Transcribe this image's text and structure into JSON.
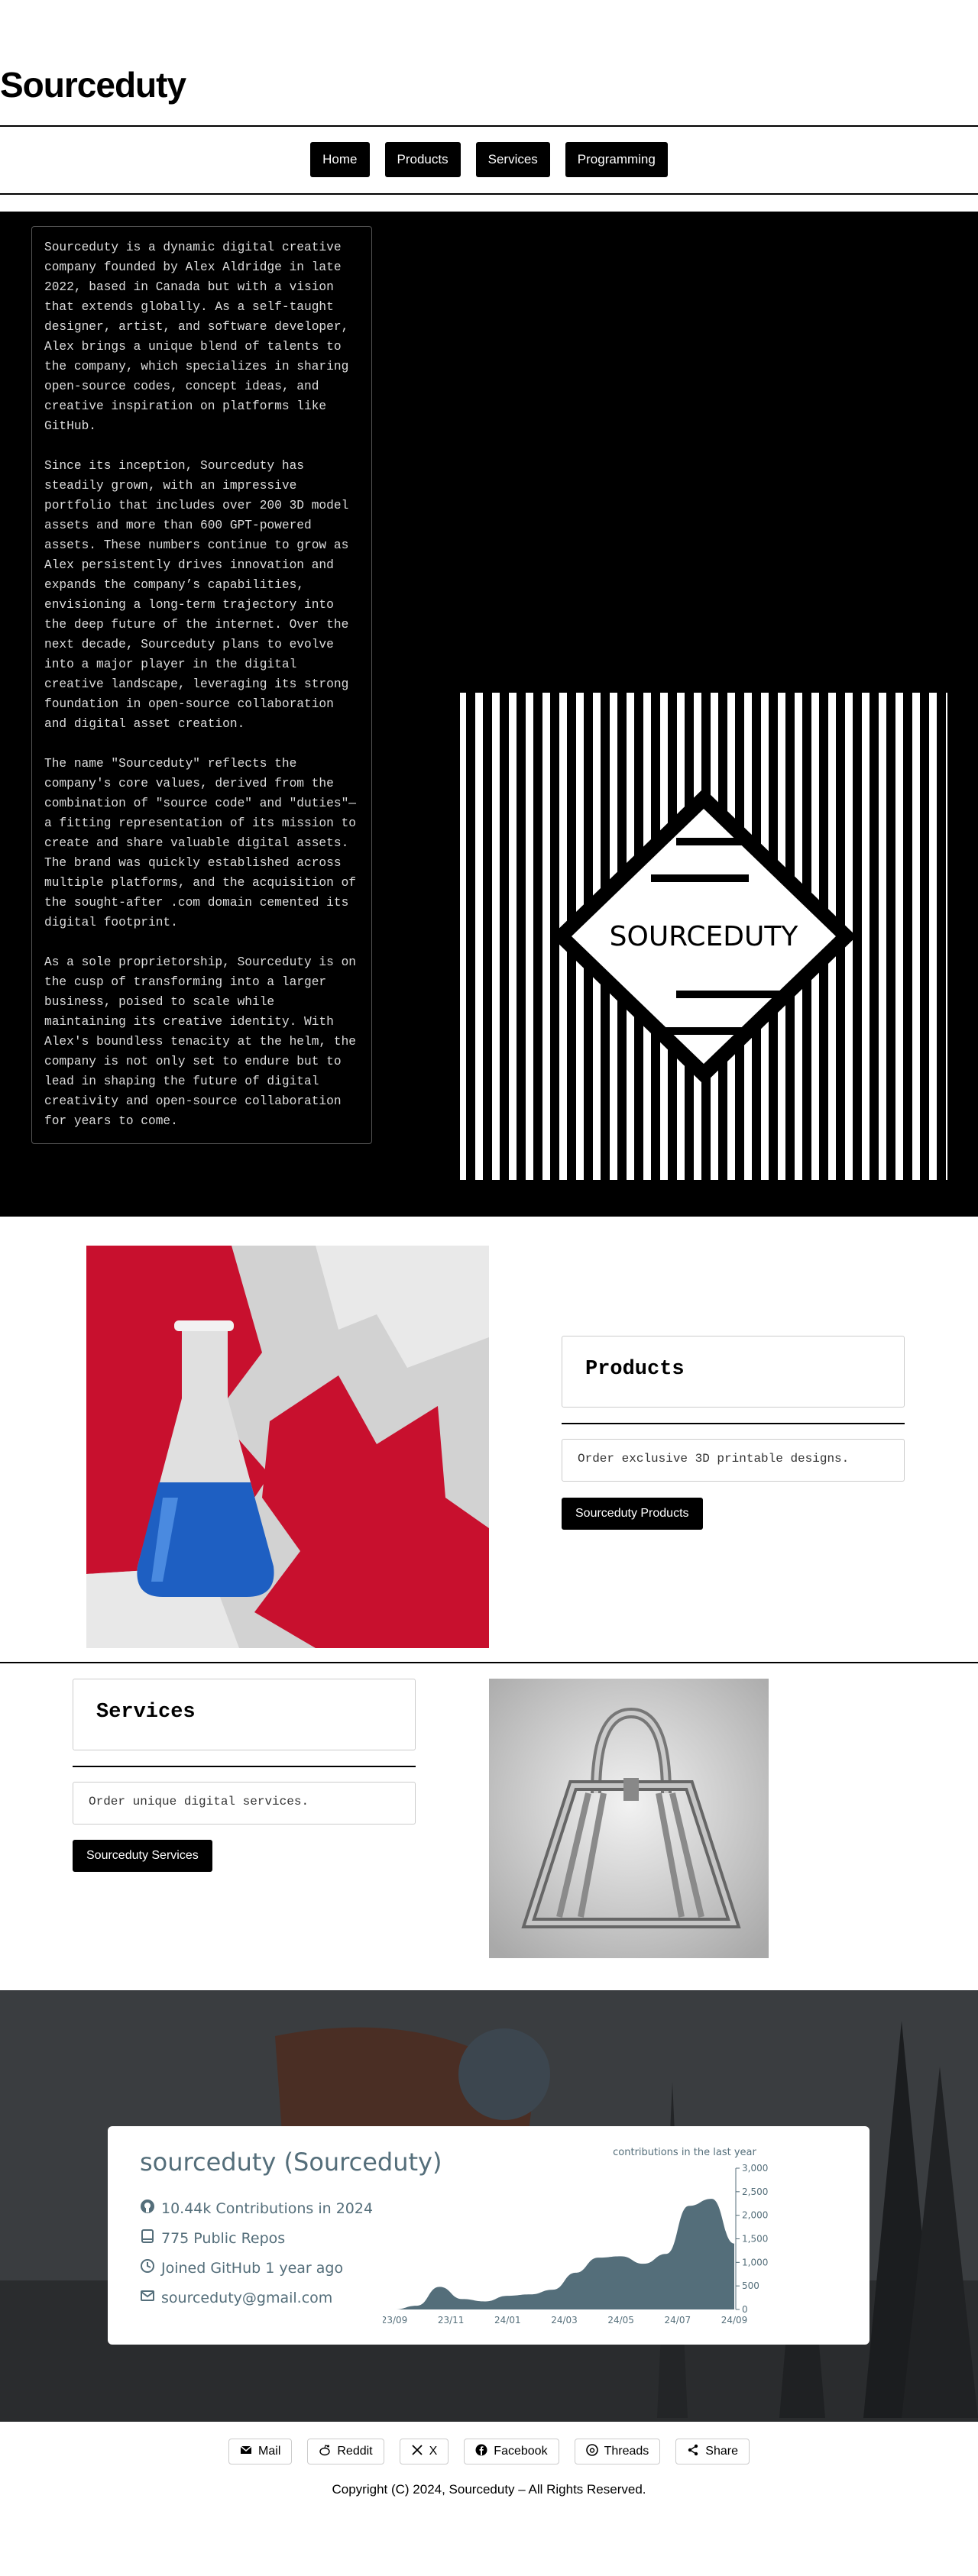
{
  "site": {
    "title": "Sourceduty"
  },
  "nav": [
    {
      "label": "Home"
    },
    {
      "label": "Products"
    },
    {
      "label": "Services"
    },
    {
      "label": "Programming"
    }
  ],
  "about": {
    "paragraphs": [
      "Sourceduty is a dynamic digital creative company founded by Alex Aldridge in late 2022, based in Canada but with a vision that extends globally. As a self-taught designer, artist, and software developer, Alex brings a unique blend of talents to the company, which specializes in sharing open-source codes, concept ideas, and creative inspiration on platforms like GitHub.",
      "Since its inception, Sourceduty has steadily grown, with an impressive portfolio that includes over 200 3D model assets and more than 600 GPT-powered assets. These numbers continue to grow as Alex persistently drives innovation and expands the company’s capabilities, envisioning a long-term trajectory into the deep future of the internet. Over the next decade, Sourceduty plans to evolve into a major player in the digital creative landscape, leveraging its strong foundation in open-source collaboration and digital asset creation.",
      "The name \"Sourceduty\" reflects the company's core values, derived from the combination of \"source code\" and \"duties\"—a fitting representation of its mission to create and share valuable digital assets. The brand was quickly established across multiple platforms, and the acquisition of the sought-after .com domain cemented its digital footprint.",
      "As a sole proprietorship, Sourceduty is on the cusp of transforming into a larger business, poised to scale while maintaining its creative identity. With Alex's boundless tenacity at the helm, the company is not only set to endure but to lead in shaping the future of digital creativity and open-source collaboration for years to come."
    ],
    "logo_text": "SOURCEDUTY"
  },
  "products": {
    "title": "Products",
    "description": "Order exclusive 3D printable designs.",
    "button": "Sourceduty Products"
  },
  "services": {
    "title": "Services",
    "description": "Order unique digital services.",
    "button": "Sourceduty Services"
  },
  "github": {
    "name": "sourceduty (Sourceduty)",
    "contributions": "10.44k Contributions in 2024",
    "repos": "775 Public Repos",
    "joined": "Joined GitHub 1 year ago",
    "email": "sourceduty@gmail.com",
    "chart_caption": "contributions in the last year"
  },
  "chart_data": {
    "type": "area",
    "title": "contributions in the last year",
    "x": [
      "23/09",
      "23/11",
      "24/01",
      "24/03",
      "24/05",
      "24/07",
      "24/09"
    ],
    "values": [
      0,
      80,
      480,
      220,
      170,
      290,
      320,
      420,
      780,
      1100,
      1130,
      970,
      1180,
      2200,
      2350,
      1400
    ],
    "ylim": [
      0,
      3000
    ],
    "yticks": [
      "0",
      "500",
      "1,000",
      "1,500",
      "2,000",
      "2,500",
      "3,000"
    ],
    "color": "#546e7a"
  },
  "share": [
    {
      "label": "Mail",
      "icon": "mail-icon"
    },
    {
      "label": "Reddit",
      "icon": "reddit-icon"
    },
    {
      "label": "X",
      "icon": "x-icon"
    },
    {
      "label": "Facebook",
      "icon": "facebook-icon"
    },
    {
      "label": "Threads",
      "icon": "threads-icon"
    },
    {
      "label": "Share",
      "icon": "share-icon"
    }
  ],
  "footer": {
    "copyright": "Copyright (C) 2024, Sourceduty – All Rights Reserved."
  }
}
